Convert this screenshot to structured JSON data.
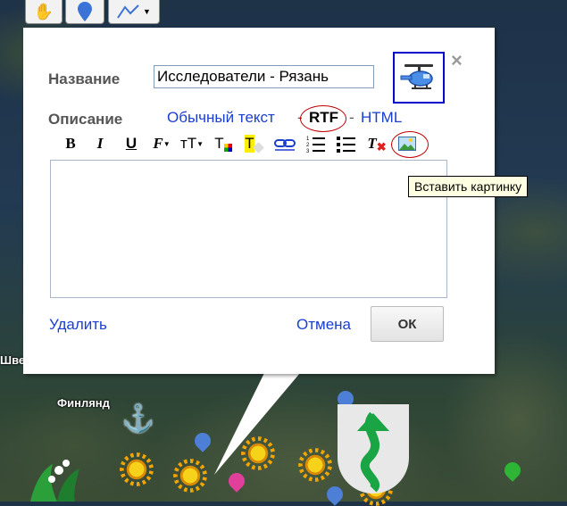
{
  "map": {
    "labels": {
      "sweden_partial": "Шве",
      "finland": "Финлянд"
    }
  },
  "toolbar": {
    "hand_icon": "hand-icon",
    "placemark_icon": "placemark-icon",
    "line_icon": "line-tool-icon"
  },
  "balloon": {
    "name_label": "Название",
    "name_value": "Исследователи - Рязань",
    "description_label": "Описание",
    "format_plain": "Обычный текст",
    "format_sep1": "-",
    "format_rtf": "RTF",
    "format_sep2": "-",
    "format_html": "HTML",
    "close_glyph": "×",
    "delete_label": "Удалить",
    "cancel_label": "Отмена",
    "ok_label": "ОК",
    "editor_value": ""
  },
  "rte_toolbar": {
    "bold": "B",
    "italic": "I",
    "underline": "U",
    "font": "F",
    "size": "тT",
    "text_color": "T",
    "highlight": "T",
    "clear_format": "T"
  },
  "tooltip": {
    "text": "Вставить картинку"
  },
  "colors": {
    "accent_link": "#1a3fcf",
    "highlight_oval": "#c00000",
    "icon_border": "#0000cc"
  }
}
